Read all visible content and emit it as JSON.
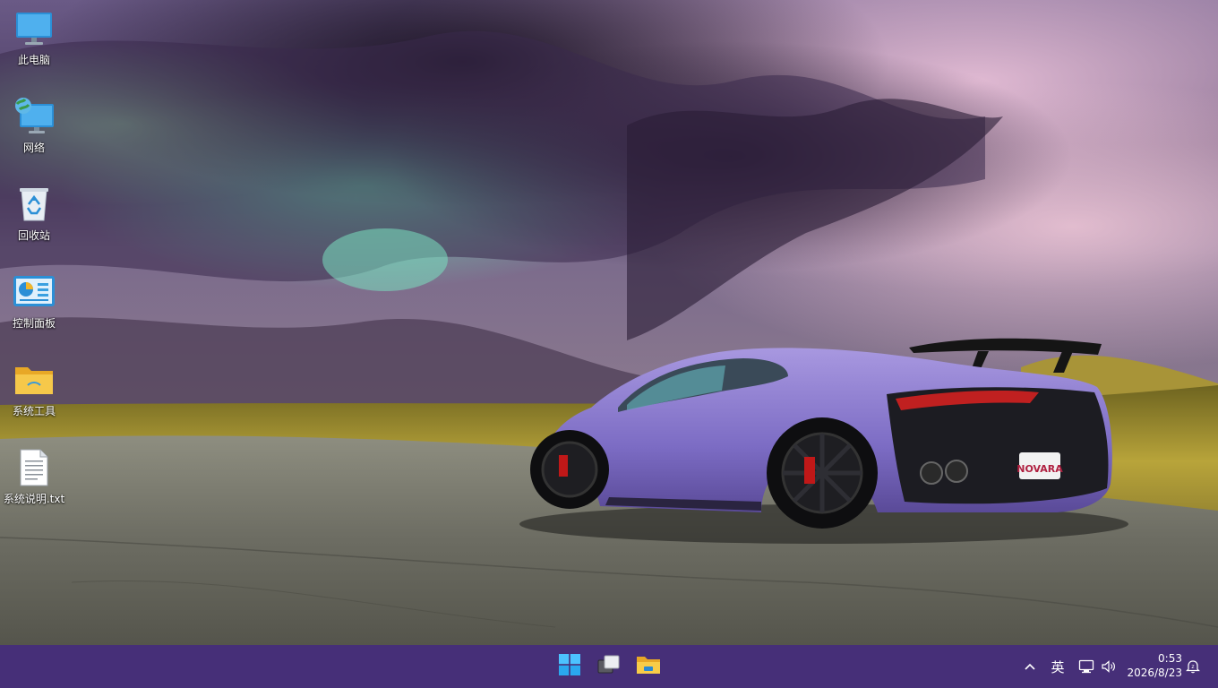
{
  "desktop": {
    "icons": [
      {
        "label": "此电脑",
        "icon": "computer-icon"
      },
      {
        "label": "网络",
        "icon": "network-icon"
      },
      {
        "label": "回收站",
        "icon": "recycle-bin-icon"
      },
      {
        "label": "控制面板",
        "icon": "control-panel-icon"
      },
      {
        "label": "系统工具",
        "icon": "folder-icon"
      },
      {
        "label": "系统说明.txt",
        "icon": "text-file-icon"
      }
    ],
    "wallpaper": {
      "plate_text": "NOVARA",
      "colors": {
        "sky_dark": "#2b1e3c",
        "sky_pink": "#c9a0c8",
        "sky_teal": "#5fc9a8",
        "field": "#9c8a2a",
        "road": "#7c7a6c",
        "car": "#8a78c9"
      }
    }
  },
  "taskbar": {
    "background": "#462f78",
    "apps": [
      {
        "name": "start",
        "icon": "windows-logo-icon"
      },
      {
        "name": "task-view",
        "icon": "task-view-icon"
      },
      {
        "name": "file-explorer",
        "icon": "file-explorer-icon"
      }
    ],
    "tray": {
      "chevron": "^",
      "ime": "英",
      "network_icon": "network-tray-icon",
      "volume_icon": "volume-icon",
      "time": "0:53",
      "date": "2026/8/23",
      "notification_icon": "notification-icon"
    }
  }
}
